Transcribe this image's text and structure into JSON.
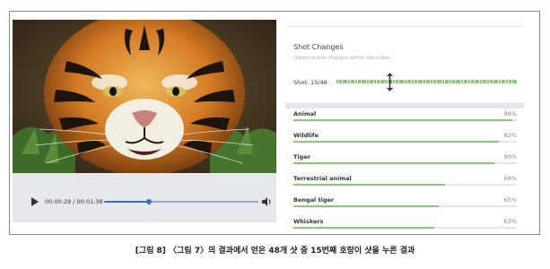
{
  "player": {
    "current_time": "00:00:29",
    "time_separator": " / ",
    "duration": "00:01:38",
    "progress": 0.29,
    "icons": {
      "play": "play-icon",
      "volume": "volume-icon"
    }
  },
  "shot_changes": {
    "title": "Shot Changes",
    "subtitle": "Detect scene changes within the video.",
    "counter": "Shot: 15/48",
    "current_shot": 15,
    "total_shots": 48
  },
  "labels": [
    {
      "name": "Animal",
      "confidence": "98%",
      "value": 98
    },
    {
      "name": "Wildlife",
      "confidence": "92%",
      "value": 92
    },
    {
      "name": "Tiger",
      "confidence": "90%",
      "value": 90
    },
    {
      "name": "Terrestrial animal",
      "confidence": "68%",
      "value": 68
    },
    {
      "name": "Bengal tiger",
      "confidence": "65%",
      "value": 65
    },
    {
      "name": "Whiskers",
      "confidence": "63%",
      "value": 63
    }
  ],
  "caption": "[그림 8] 〈그림 7〉의 결과에서 얻은 48개 샷 중 15번째 호랑이 샷을 누른 결과",
  "colors": {
    "accent": "#3c6ebc",
    "bar_green": "#8ec67a",
    "panel_bg": "#e6e8ec"
  }
}
